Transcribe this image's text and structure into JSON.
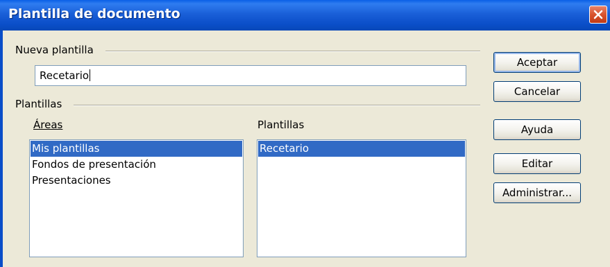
{
  "window": {
    "title": "Plantilla de documento"
  },
  "new_template": {
    "group_label": "Nueva plantilla",
    "value": "Recetario"
  },
  "templates_group": {
    "group_label": "Plantillas",
    "areas": {
      "label": "Áreas",
      "items": [
        "Mis plantillas",
        "Fondos de presentación",
        "Presentaciones"
      ],
      "selected": "Mis plantillas"
    },
    "templates": {
      "label": "Plantillas",
      "items": [
        "Recetario"
      ],
      "selected": "Recetario"
    }
  },
  "buttons": {
    "ok": "Aceptar",
    "cancel": "Cancelar",
    "help": "Ayuda",
    "edit": "Editar",
    "manage": "Administrar..."
  },
  "colors": {
    "title_bar": "#0a4ec8",
    "selection": "#316ac5",
    "dialog_bg": "#ece9d8",
    "close_button": "#d8532e"
  }
}
